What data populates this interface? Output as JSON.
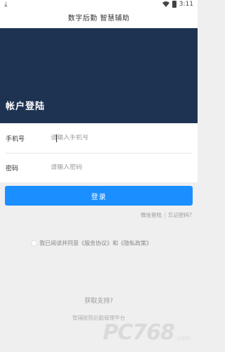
{
  "status_bar": {
    "download_icon": "download-icon",
    "time": "3:11"
  },
  "header": {
    "title": "数字后勤 智慧辅助"
  },
  "banner": {
    "title": "帐户登陆",
    "background": "#1e3352"
  },
  "form": {
    "phone_label": "手机号",
    "phone_placeholder": "请输入手机号",
    "password_label": "密码",
    "password_placeholder": "请输入密码"
  },
  "login_button": {
    "label": "登录",
    "color": "#1a8fff"
  },
  "links": {
    "wechat_login": "微信登陆",
    "forgot_password": "忘记密码?"
  },
  "agreement": {
    "text": "我已阅读并同意《服务协议》和《隐私政策》"
  },
  "support": {
    "text": "获取支持?"
  },
  "footer": {
    "text": "智辅医院后勤管理平台"
  },
  "watermark": {
    "text": "PC768",
    "sub": ".com"
  }
}
